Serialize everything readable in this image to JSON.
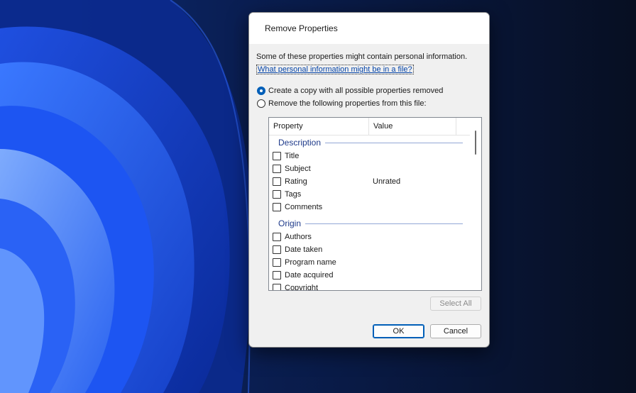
{
  "dialog": {
    "title": "Remove Properties",
    "intro": "Some of these properties might contain personal information.",
    "link": "What personal information might be in a file?",
    "option_copy": "Create a copy with all possible properties removed",
    "option_remove": "Remove the following properties from this file:",
    "selected_option": "copy"
  },
  "list": {
    "headers": {
      "property": "Property",
      "value": "Value"
    },
    "groups": [
      {
        "label": "Description",
        "rows": [
          {
            "name": "Title",
            "value": ""
          },
          {
            "name": "Subject",
            "value": ""
          },
          {
            "name": "Rating",
            "value": "Unrated"
          },
          {
            "name": "Tags",
            "value": ""
          },
          {
            "name": "Comments",
            "value": ""
          }
        ]
      },
      {
        "label": "Origin",
        "rows": [
          {
            "name": "Authors",
            "value": ""
          },
          {
            "name": "Date taken",
            "value": ""
          },
          {
            "name": "Program name",
            "value": ""
          },
          {
            "name": "Date acquired",
            "value": ""
          },
          {
            "name": "Copyright",
            "value": ""
          }
        ]
      }
    ]
  },
  "buttons": {
    "select_all": "Select All",
    "ok": "OK",
    "cancel": "Cancel"
  },
  "colors": {
    "accent": "#005fb8",
    "group_label": "#1e3a8a",
    "link": "#0645a8"
  }
}
